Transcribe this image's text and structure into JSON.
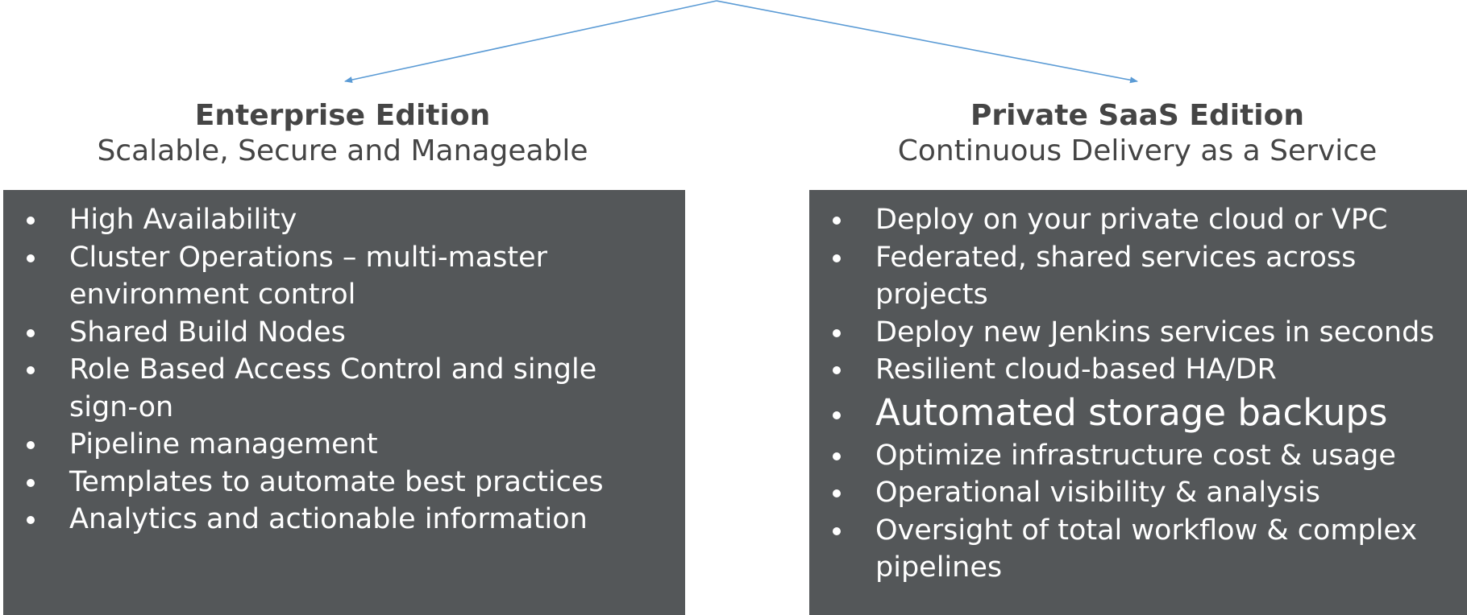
{
  "colors": {
    "connector": "#5b9bd5",
    "box_background": "#545759",
    "box_text": "#ffffff",
    "heading_text": "#454545"
  },
  "enterprise": {
    "title": "Enterprise Edition",
    "subtitle": "Scalable, Secure and Manageable",
    "items": [
      "High Availability",
      "Cluster Operations – multi-master environment control",
      "Shared Build Nodes",
      "Role Based Access Control and single sign-on",
      "Pipeline management",
      "Templates to automate best practices",
      "Analytics and actionable information"
    ]
  },
  "saas": {
    "title": "Private SaaS Edition",
    "subtitle": "Continuous Delivery as a Service",
    "items": [
      "Deploy on your private cloud or VPC",
      "Federated, shared services across projects",
      "Deploy new Jenkins services in seconds",
      "Resilient cloud-based HA/DR",
      "Automated storage backups",
      "Optimize infrastructure cost & usage",
      "Operational visibility & analysis",
      "Oversight of total workflow & complex pipelines"
    ]
  }
}
